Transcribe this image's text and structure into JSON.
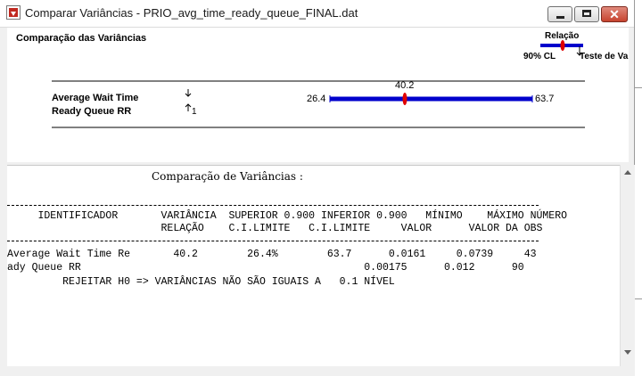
{
  "window": {
    "title": "Comparar Variâncias - PRIO_avg_time_ready_queue_FINAL.dat"
  },
  "colors": {
    "interval_bar": "#0000cc",
    "marker": "#e00000"
  },
  "chart": {
    "title": "Comparação das Variâncias",
    "legend": {
      "relacao": "Relação",
      "cl": "90% CL",
      "teste": "Teste de Va"
    },
    "row_label_1": "Average Wait Time",
    "row_label_2": "Ready Queue RR",
    "arrow_index": "1"
  },
  "chart_data": {
    "type": "interval",
    "items": [
      {
        "name": "Average Wait Time Ready Queue RR",
        "lower": 26.4,
        "estimate": 40.2,
        "upper": 63.7
      }
    ],
    "labels": {
      "lower": "26.4",
      "estimate": "40.2",
      "upper": "63.7"
    }
  },
  "report": {
    "title": "Comparação de Variâncias :",
    "header1": "     IDENTIFICADOR       VARIÂNCIA  SUPERIOR 0.900 INFERIOR 0.900   MÍNIMO    MÁXIMO NÚMERO",
    "header2": "                         RELAÇÃO    C.I.LIMITE   C.I.LIMITE     VALOR      VALOR DA OBS",
    "row1": "Average Wait Time Re       40.2        26.4%        63.7      0.0161     0.0739     43",
    "row2": "ady Queue RR                                              0.00175      0.012      90",
    "conclusion": "         REJEITAR H0 => VARIÂNCIAS NÃO SÃO IGUAIS A   0.1 NÍVEL"
  }
}
